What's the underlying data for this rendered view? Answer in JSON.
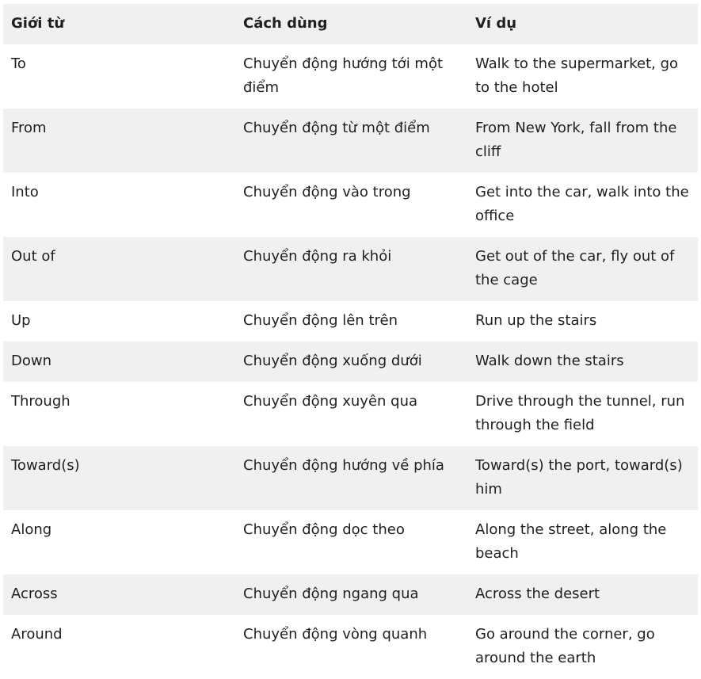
{
  "table": {
    "headers": [
      "Giới từ",
      "Cách dùng",
      "Ví dụ"
    ],
    "rows": [
      [
        "To",
        "Chuyển động hướng tới một điểm",
        "Walk to the supermarket, go to the hotel"
      ],
      [
        "From",
        "Chuyển động từ một điểm",
        "From New York, fall from the cliff"
      ],
      [
        "Into",
        "Chuyển động vào trong",
        "Get into the car, walk into the office"
      ],
      [
        "Out of",
        "Chuyển động ra khỏi",
        "Get out of the car, fly out of the cage"
      ],
      [
        "Up",
        "Chuyển động lên trên",
        "Run up the stairs"
      ],
      [
        "Down",
        "Chuyển động xuống dưới",
        "Walk down the stairs"
      ],
      [
        "Through",
        "Chuyển động xuyên qua",
        "Drive through the tunnel, run through the field"
      ],
      [
        "Toward(s)",
        "Chuyển động hướng về phía",
        "Toward(s) the port, toward(s) him"
      ],
      [
        "Along",
        "Chuyển động dọc theo",
        "Along the street, along the beach"
      ],
      [
        "Across",
        "Chuyển động ngang qua",
        "Across the desert"
      ],
      [
        "Around",
        "Chuyển động vòng quanh",
        "Go around the corner, go around the earth"
      ]
    ]
  }
}
